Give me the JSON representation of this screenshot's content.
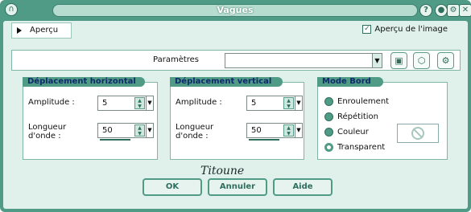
{
  "window": {
    "title": "Vagues"
  },
  "toolbar": {
    "preview_label": "Aperçu",
    "image_preview_label": "Aperçu de l'image",
    "image_preview_checked": true
  },
  "params": {
    "label": "Paramètres",
    "preset_value": ""
  },
  "groups": {
    "horizontal": {
      "title": "Déplacement horizontal",
      "amplitude_label": "Amplitude :",
      "amplitude_value": "5",
      "wavelength_label": "Longueur d'onde :",
      "wavelength_value": "50"
    },
    "vertical": {
      "title": "Déplacement vertical",
      "amplitude_label": "Amplitude :",
      "amplitude_value": "5",
      "wavelength_label": "Longueur d'onde :",
      "wavelength_value": "50"
    },
    "edge_mode": {
      "title": "Mode Bord",
      "options": [
        "Enroulement",
        "Répétition",
        "Couleur",
        "Transparent"
      ],
      "selected": "Transparent"
    }
  },
  "watermark": "Titoune",
  "buttons": {
    "ok": "OK",
    "cancel": "Annuler",
    "help": "Aide"
  },
  "colors": {
    "frame": "#4f9b86",
    "client": "#dff1ea",
    "group_title_text": "#102a6b"
  },
  "icons": [
    "help-icon",
    "round-button-icon",
    "settings-icon",
    "close-icon",
    "save-icon",
    "randomize-icon",
    "preset-manage-icon",
    "no-entry-icon"
  ]
}
